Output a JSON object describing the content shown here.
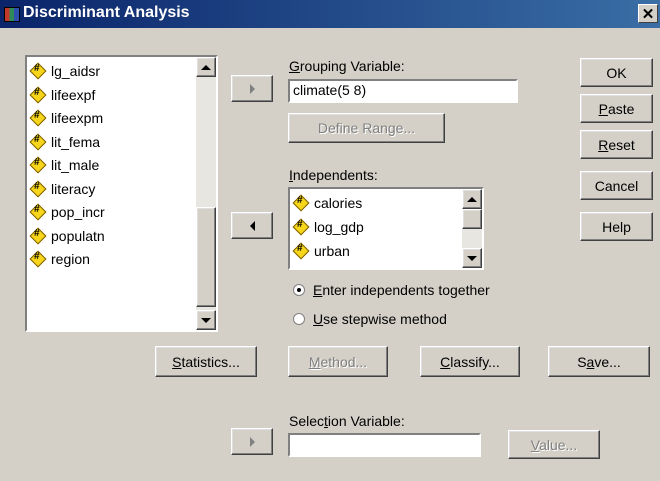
{
  "window": {
    "title": "Discriminant Analysis",
    "close_glyph": "✕"
  },
  "source_list": {
    "items": [
      "lg_aidsr",
      "lifeexpf",
      "lifeexpm",
      "lit_fema",
      "lit_male",
      "literacy",
      "pop_incr",
      "populatn",
      "region"
    ]
  },
  "grouping": {
    "label": "Grouping Variable:",
    "value": "climate(5 8)",
    "define_range_label": "Define Range..."
  },
  "independents": {
    "label": "Independents:",
    "items": [
      "calories",
      "log_gdp",
      "urban"
    ]
  },
  "method_options": {
    "enter_together": "Enter independents together",
    "stepwise": "Use stepwise method",
    "selected": "enter_together"
  },
  "side_buttons": {
    "ok": "OK",
    "paste": "Paste",
    "reset": "Reset",
    "cancel": "Cancel",
    "help": "Help"
  },
  "bottom_buttons": {
    "statistics": "Statistics...",
    "method": "Method...",
    "classify": "Classify...",
    "save": "Save..."
  },
  "selection": {
    "label": "Selection Variable:",
    "value": "",
    "value_button": "Value..."
  }
}
